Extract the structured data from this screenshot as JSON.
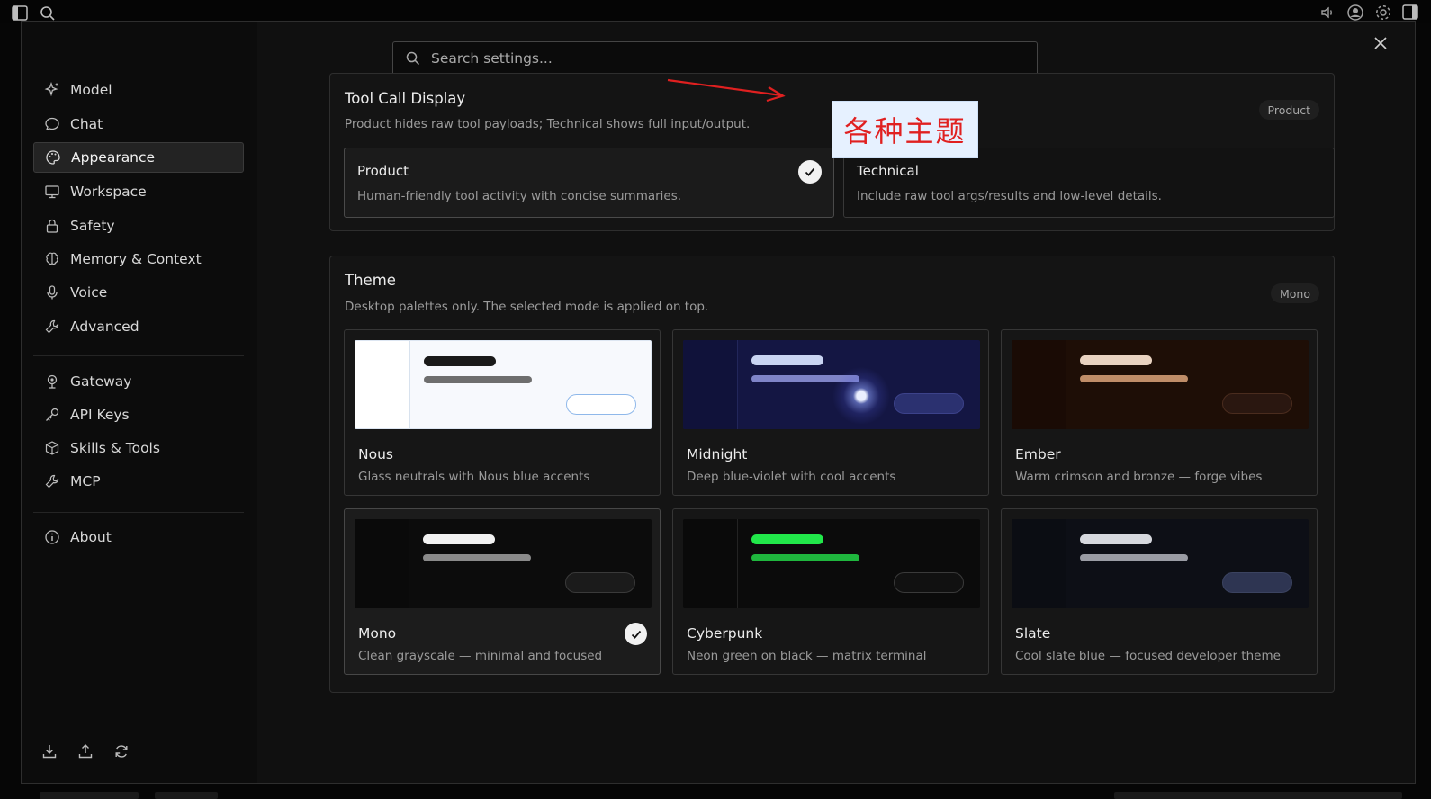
{
  "search": {
    "placeholder": "Search settings..."
  },
  "sidebar": {
    "items": [
      {
        "label": "Model",
        "icon": "sparkles-icon"
      },
      {
        "label": "Chat",
        "icon": "chat-bubble-icon"
      },
      {
        "label": "Appearance",
        "icon": "palette-icon",
        "active": true
      },
      {
        "label": "Workspace",
        "icon": "monitor-icon"
      },
      {
        "label": "Safety",
        "icon": "lock-icon"
      },
      {
        "label": "Memory & Context",
        "icon": "brain-icon"
      },
      {
        "label": "Voice",
        "icon": "microphone-icon"
      },
      {
        "label": "Advanced",
        "icon": "wrench-icon"
      },
      {
        "label": "Gateway",
        "icon": "gateway-icon"
      },
      {
        "label": "API Keys",
        "icon": "key-icon"
      },
      {
        "label": "Skills & Tools",
        "icon": "box-icon"
      },
      {
        "label": "MCP",
        "icon": "plug-icon"
      },
      {
        "label": "About",
        "icon": "info-icon"
      }
    ],
    "footer_icons": [
      "download-icon",
      "upload-icon",
      "refresh-icon"
    ]
  },
  "tool_call": {
    "title": "Tool Call Display",
    "description": "Product hides raw tool payloads; Technical shows full input/output.",
    "badge": "Product",
    "options": [
      {
        "title": "Product",
        "description": "Human-friendly tool activity with concise summaries.",
        "selected": true
      },
      {
        "title": "Technical",
        "description": "Include raw tool args/results and low-level details.",
        "selected": false
      }
    ]
  },
  "theme": {
    "title": "Theme",
    "description": "Desktop palettes only. The selected mode is applied on top.",
    "badge": "Mono",
    "options": [
      {
        "name": "Nous",
        "description": "Glass neutrals with Nous blue accents",
        "selected": false,
        "colors": {
          "bg": "#f7f9fd",
          "side": "#ffffff",
          "divider": "#d8e2ee",
          "bar1": "#1a1a1a",
          "bar2": "#6e6e6e",
          "pill_bg": "#ffffff",
          "pill_border": "#8fb8ea"
        }
      },
      {
        "name": "Midnight",
        "description": "Deep blue-violet with cool accents",
        "selected": false,
        "colors": {
          "bg": "#141643",
          "side": "#10123a",
          "divider": "#22265a",
          "bar1": "#c9d4f2",
          "bar2": "#7f84c8",
          "pill_bg": "#2b3170",
          "pill_border": "#3c428a"
        }
      },
      {
        "name": "Ember",
        "description": "Warm crimson and bronze — forge vibes",
        "selected": false,
        "colors": {
          "bg": "#1e0e06",
          "side": "#1a0b05",
          "divider": "#2e1810",
          "bar1": "#e9d2c0",
          "bar2": "#c08d68",
          "pill_bg": "#2a1710",
          "pill_border": "#4a2c1e"
        }
      },
      {
        "name": "Mono",
        "description": "Clean grayscale — minimal and focused",
        "selected": true,
        "colors": {
          "bg": "#0c0c0c",
          "side": "#0a0a0a",
          "divider": "#252525",
          "bar1": "#f2f2f2",
          "bar2": "#8a8a8a",
          "pill_bg": "#1b1b1b",
          "pill_border": "#3a3a3a"
        }
      },
      {
        "name": "Cyberpunk",
        "description": "Neon green on black — matrix terminal",
        "selected": false,
        "colors": {
          "bg": "#0b0b0b",
          "side": "#0a0a0a",
          "divider": "#232323",
          "bar1": "#21e84a",
          "bar2": "#1fb73e",
          "pill_bg": "#111111",
          "pill_border": "#3a3a3a"
        }
      },
      {
        "name": "Slate",
        "description": "Cool slate blue — focused developer theme",
        "selected": false,
        "colors": {
          "bg": "#0d0f16",
          "side": "#0b0d13",
          "divider": "#20242f",
          "bar1": "#d6d8de",
          "bar2": "#9a9ca4",
          "pill_bg": "#2e3552",
          "pill_border": "#3b4360"
        }
      }
    ]
  },
  "annotation": {
    "text": "各种主题",
    "color": "#e02020",
    "arrow_color": "#e02020"
  }
}
